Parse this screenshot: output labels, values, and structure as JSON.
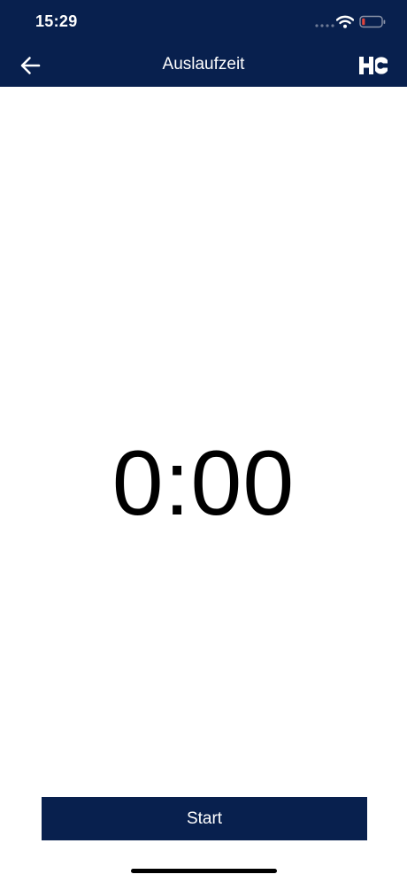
{
  "status_bar": {
    "time": "15:29",
    "icons": [
      "signal-icon",
      "wifi-icon",
      "battery-low-icon"
    ]
  },
  "nav": {
    "title": "Auslaufzeit",
    "back_icon": "arrow-left-icon",
    "logo_icon": "hc-logo-icon"
  },
  "timer": {
    "value": "0:00"
  },
  "actions": {
    "start_label": "Start"
  },
  "colors": {
    "primary": "#08204e",
    "background": "#ffffff",
    "text": "#000000",
    "battery_low": "#e0443c"
  }
}
